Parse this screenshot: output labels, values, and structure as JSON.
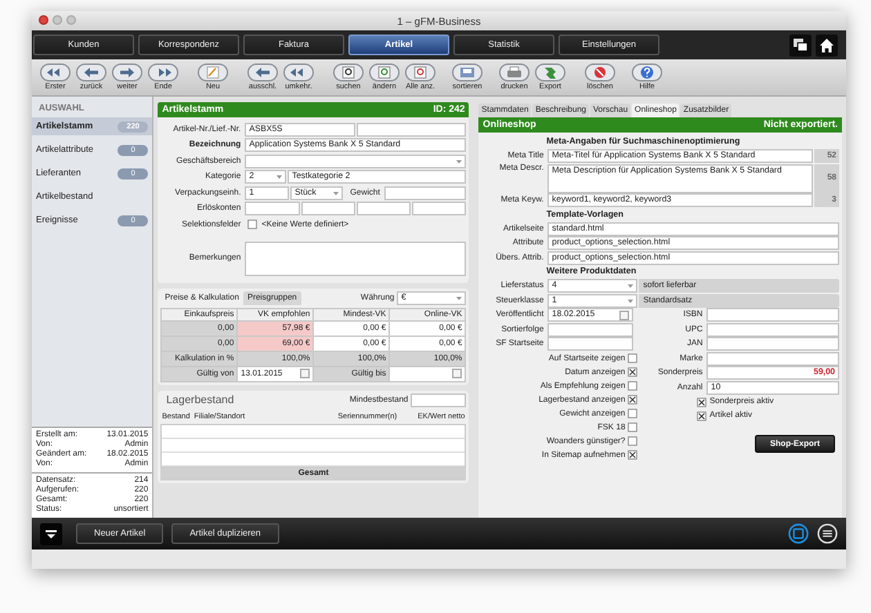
{
  "window": {
    "title": "1 – gFM-Business"
  },
  "nav_tabs": [
    {
      "label": "Kunden",
      "selected": false
    },
    {
      "label": "Korrespondenz",
      "selected": false
    },
    {
      "label": "Faktura",
      "selected": false
    },
    {
      "label": "Artikel",
      "selected": true
    },
    {
      "label": "Statistik",
      "selected": false
    },
    {
      "label": "Einstellungen",
      "selected": false
    }
  ],
  "toolbar": [
    {
      "label": "Erster"
    },
    {
      "label": "zurück"
    },
    {
      "label": "weiter"
    },
    {
      "label": "Ende"
    },
    {
      "label": "Neu"
    },
    {
      "label": "ausschl."
    },
    {
      "label": "umkehr."
    },
    {
      "label": "suchen"
    },
    {
      "label": "ändern"
    },
    {
      "label": "Alle anz."
    },
    {
      "label": "sortieren"
    },
    {
      "label": "drucken"
    },
    {
      "label": "Export"
    },
    {
      "label": "löschen"
    },
    {
      "label": "Hilfe"
    }
  ],
  "sidebar": {
    "heading": "AUSWAHL",
    "items": [
      {
        "label": "Artikelstamm",
        "count": "220",
        "selected": true
      },
      {
        "label": "Artikelattribute",
        "count": "0",
        "selected": false
      },
      {
        "label": "Lieferanten",
        "count": "0",
        "selected": false
      },
      {
        "label": "Artikelbestand",
        "selected": false
      },
      {
        "label": "Ereignisse",
        "count": "0",
        "selected": false
      }
    ],
    "record_info": [
      {
        "label": "Erstellt am:",
        "value": "13.01.2015"
      },
      {
        "label": "Von:",
        "value": "Admin"
      },
      {
        "label": "Geändert am:",
        "value": "18.02.2015"
      },
      {
        "label": "Von:",
        "value": "Admin"
      }
    ],
    "record_stats": [
      {
        "label": "Datensatz:",
        "value": "214"
      },
      {
        "label": "Aufgerufen:",
        "value": "220"
      },
      {
        "label": "Gesamt:",
        "value": "220"
      },
      {
        "label": "Status:",
        "value": "unsortiert"
      }
    ]
  },
  "article": {
    "title": "Artikelstamm",
    "id": "ID: 242",
    "number_label": "Artikel-Nr./Lief.-Nr.",
    "number": "ASBX5S",
    "name_label": "Bezeichnung",
    "name": "Application Systems Bank X 5 Standard",
    "area_label": "Geschäftsbereich",
    "category_label": "Kategorie",
    "category_code": "2",
    "category": "Testkategorie 2",
    "packaging_label": "Verpackungseinh.",
    "packaging_qty": "1",
    "packaging_unit": "Stück",
    "weight_label": "Gewicht",
    "revenue_label": "Erlöskonten",
    "selection_label": "Selektionsfelder",
    "selection_checked": false,
    "selection_text": "<Keine Werte definiert>",
    "remarks_label": "Bemerkungen"
  },
  "prices": {
    "tabs": [
      {
        "label": "Preise & Kalkulation",
        "selected": true
      },
      {
        "label": "Preisgruppen",
        "selected": false
      }
    ],
    "currency_label": "Währung",
    "currency": "€",
    "columns": [
      "Einkaufspreis",
      "VK empfohlen",
      "Mindest-VK",
      "Online-VK"
    ],
    "rows": [
      [
        "0,00",
        "57,98 €",
        "0,00 €",
        "0,00 €"
      ],
      [
        "0,00",
        "69,00 €",
        "0,00 €",
        "0,00 €"
      ]
    ],
    "calc_label": "Kalkulation in %",
    "calc": [
      "100,0%",
      "100,0%",
      "100,0%"
    ],
    "valid_from_label": "Gültig von",
    "valid_from": "13.01.2015",
    "valid_to_label": "Gültig bis"
  },
  "stock": {
    "title": "Lagerbestand",
    "min_label": "Mindestbestand",
    "columns": [
      "Bestand",
      "Filiale/Standort",
      "Seriennummer(n)",
      "EK/Wert netto"
    ],
    "footer": "Gesamt"
  },
  "detail_tabs": [
    {
      "label": "Stammdaten",
      "selected": false
    },
    {
      "label": "Beschreibung",
      "selected": false
    },
    {
      "label": "Vorschau",
      "selected": false
    },
    {
      "label": "Onlineshop",
      "selected": true
    },
    {
      "label": "Zusatzbilder",
      "selected": false
    }
  ],
  "shop": {
    "title": "Onlineshop",
    "status": "Nicht exportiert.",
    "meta_heading": "Meta-Angaben für Suchmaschinenoptimierung",
    "meta": [
      {
        "label": "Meta Title",
        "value": "Meta-Titel für Application Systems Bank X 5 Standard",
        "count": "52"
      },
      {
        "label": "Meta Descr.",
        "value": "Meta Description für Application Systems Bank X 5 Standard",
        "count": "58",
        "kind": "tall"
      },
      {
        "label": "Meta Keyw.",
        "value": "keyword1, keyword2, keyword3",
        "count": "3"
      }
    ],
    "template_heading": "Template-Vorlagen",
    "templates": [
      {
        "label": "Artikelseite",
        "value": "standard.html"
      },
      {
        "label": "Attribute",
        "value": "product_options_selection.html"
      },
      {
        "label": "Übers. Attrib.",
        "value": "product_options_selection.html"
      }
    ],
    "more_heading": "Weitere Produktdaten",
    "selects": [
      {
        "label": "Lieferstatus",
        "code": "4",
        "text": "sofort lieferbar"
      },
      {
        "label": "Steuerklasse",
        "code": "1",
        "text": "Standardsatz"
      }
    ],
    "published_label": "Veröffentlicht",
    "published": "18.02.2015",
    "sort_label": "Sortierfolge",
    "start_label": "SF Startseite",
    "options": [
      {
        "label": "Auf Startseite zeigen",
        "checked": false
      },
      {
        "label": "Datum anzeigen",
        "checked": true
      },
      {
        "label": "Als Empfehlung zeigen",
        "checked": false
      },
      {
        "label": "Lagerbestand anzeigen",
        "checked": true
      },
      {
        "label": "Gewicht anzeigen",
        "checked": false
      },
      {
        "label": "FSK 18",
        "checked": false
      },
      {
        "label": "Woanders günstiger?",
        "checked": false
      },
      {
        "label": "In Sitemap aufnehmen",
        "checked": true
      }
    ],
    "codes": [
      {
        "label": "ISBN",
        "kind": "text"
      },
      {
        "label": "UPC",
        "kind": "text"
      },
      {
        "label": "JAN",
        "kind": "text"
      },
      {
        "label": "Marke",
        "kind": "text"
      },
      {
        "label": "Sonderpreis",
        "value": "59,00",
        "kind": "price"
      },
      {
        "label": "Anzahl",
        "value": "10",
        "kind": "text"
      }
    ],
    "flags": [
      {
        "label": "Sonderpreis aktiv",
        "checked": true
      },
      {
        "label": "Artikel aktiv",
        "checked": true
      }
    ],
    "export_button": "Shop-Export"
  },
  "bottom_bar": {
    "buttons": [
      "Neuer Artikel",
      "Artikel duplizieren"
    ]
  }
}
